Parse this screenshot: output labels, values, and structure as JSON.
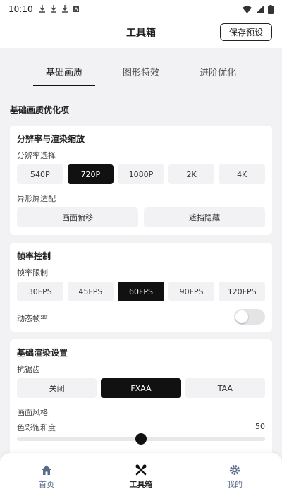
{
  "status_bar": {
    "time": "10:10",
    "battery_icon": "battery-full-icon"
  },
  "header": {
    "title": "工具箱",
    "save_label": "保存预设"
  },
  "tabs": [
    {
      "label": "基础画质",
      "active": true
    },
    {
      "label": "图形特效",
      "active": false
    },
    {
      "label": "进阶优化",
      "active": false
    }
  ],
  "section_title": "基础画质优化项",
  "resolution_card": {
    "title": "分辨率与渲染缩放",
    "resolution_label": "分辨率选择",
    "resolutions": [
      "540P",
      "720P",
      "1080P",
      "2K",
      "4K"
    ],
    "selected_resolution": "720P",
    "screen_adapt_label": "异形屏适配",
    "screen_adapt_options": [
      "画面偏移",
      "遮挡隐藏"
    ]
  },
  "framerate_card": {
    "title": "帧率控制",
    "limit_label": "帧率限制",
    "fps_options": [
      "30FPS",
      "45FPS",
      "60FPS",
      "90FPS",
      "120FPS"
    ],
    "selected_fps": "60FPS",
    "dynamic_label": "动态帧率",
    "dynamic_enabled": false
  },
  "render_card": {
    "title": "基础渲染设置",
    "aa_label": "抗锯齿",
    "aa_options": [
      "关闭",
      "FXAA",
      "TAA"
    ],
    "selected_aa": "FXAA",
    "style_label": "画面风格",
    "saturation_label": "色彩饱和度",
    "saturation_value": "50",
    "saturation_fraction": 0.5
  },
  "bottom_nav": [
    {
      "label": "首页",
      "icon": "home-icon",
      "active": false
    },
    {
      "label": "工具箱",
      "icon": "tools-icon",
      "active": true
    },
    {
      "label": "我的",
      "icon": "gear-icon",
      "active": false
    }
  ],
  "colors": {
    "accent": "#111111",
    "background": "#f2f2f4",
    "nav_inactive": "#5a6a8c"
  }
}
